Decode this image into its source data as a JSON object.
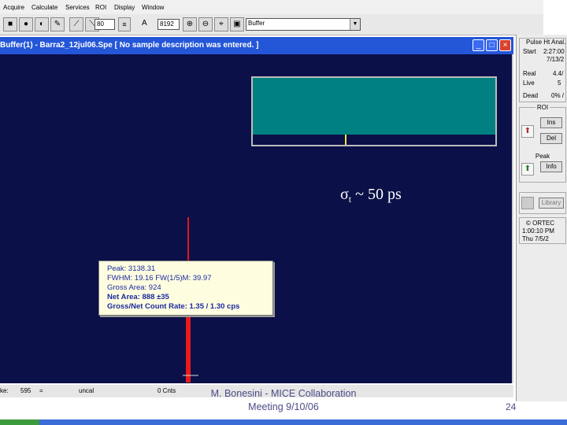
{
  "menu": {
    "items": [
      "Acquire",
      "Calculate",
      "Services",
      "ROI",
      "Display",
      "Window"
    ]
  },
  "toolbar": {
    "field_a": "80",
    "field_b_label": "A",
    "field_c": "8192",
    "buffer_select": "Buffer"
  },
  "window": {
    "title": "Buffer(1) - Barra2_12jul06.Spe  [ No sample description was entered. ]",
    "minimize": "_",
    "maximize": "□",
    "close": "×"
  },
  "overlay": {
    "sigma_symbol": "σ",
    "sigma_sub": "t",
    "sigma_rest": " ~ 50 ps"
  },
  "peak_info": {
    "peak": "Peak: 3138.31",
    "fwhm": "FWHM: 19.16  FW(1/5)M: 39.97",
    "gross_area": "Gross Area: 924",
    "net_area": "Net Area: 888 ±35",
    "rate": "Gross/Net Count Rate: 1.35 / 1.30 cps"
  },
  "status_bar": {
    "label": "ke:",
    "value": "595",
    "dash": "=",
    "uncal": "uncal",
    "cnts": "0 Cnts"
  },
  "right_panel": {
    "header": "Pulse Ht Anal.",
    "start_label": "Start",
    "start_time": "2:27:00",
    "start_date": "7/13/2",
    "real_label": "Real",
    "real_value": "4.4/",
    "live_label": "Live",
    "live_value": "5",
    "dead_label": "Dead",
    "dead_value": "0% /",
    "roi_legend": "ROI",
    "roi_ins": "Ins",
    "roi_del": "Del",
    "peak_legend": "Peak",
    "peak_info_btn": "Info",
    "library_btn": "Library",
    "ortec": "© ORTEC",
    "time": "1:00:10 PM",
    "date": "Thu   7/5/2"
  },
  "slide": {
    "footer_line1": "M. Bonesini - MICE Collaboration",
    "footer_line2": "Meeting  9/10/06",
    "page_number": "24"
  }
}
